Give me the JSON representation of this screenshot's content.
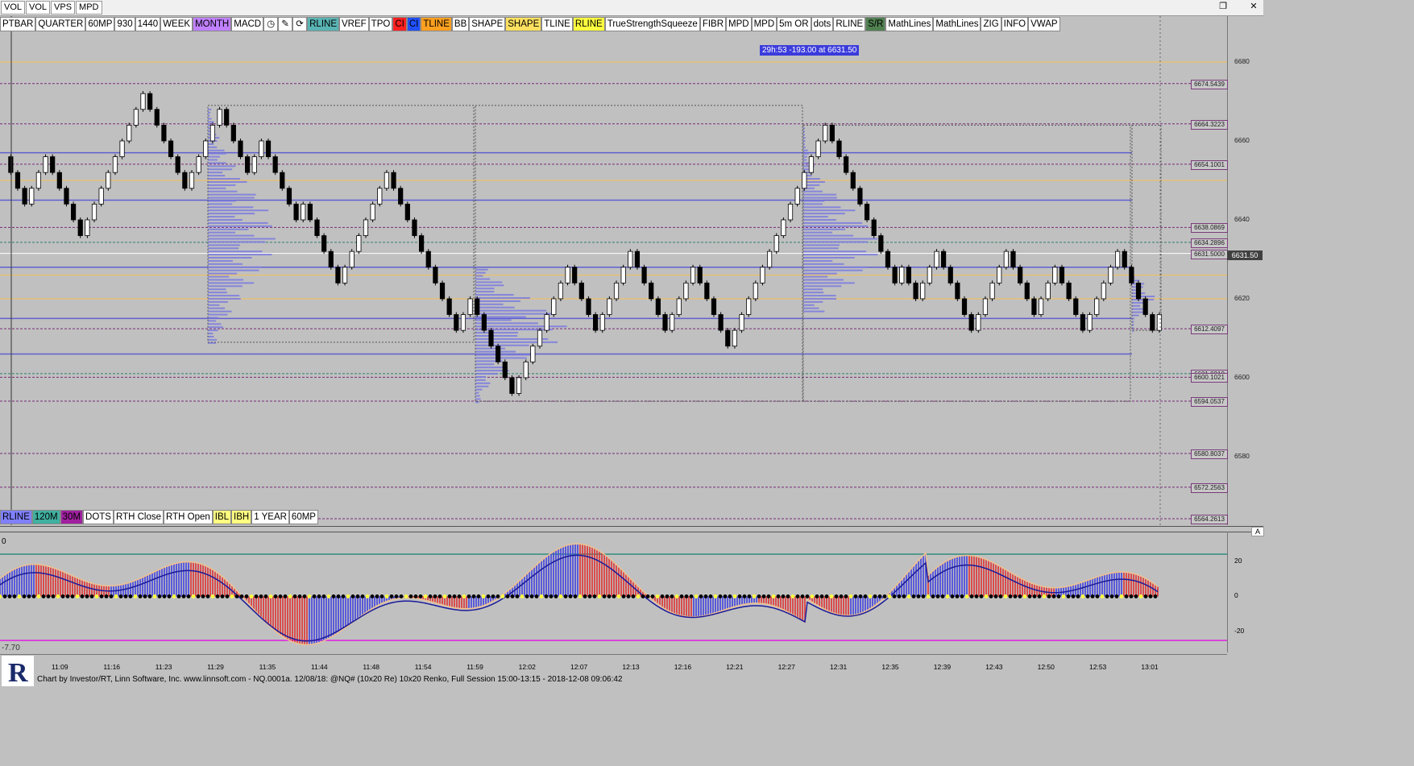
{
  "topbar": {
    "tabs": [
      "VOL",
      "VOL",
      "VPS",
      "MPD"
    ]
  },
  "toolbar": [
    {
      "label": "PTBAR",
      "bg": "#ffffff"
    },
    {
      "label": "QUARTER",
      "bg": "#ffffff"
    },
    {
      "label": "60MP",
      "bg": "#ffffff"
    },
    {
      "label": "930",
      "bg": "#ffffff"
    },
    {
      "label": "1440",
      "bg": "#ffffff"
    },
    {
      "label": "WEEK",
      "bg": "#ffffff"
    },
    {
      "label": "MONTH",
      "bg": "#c080ff"
    },
    {
      "label": "MACD",
      "bg": "#ffffff"
    },
    {
      "label": "",
      "bg": "#ffffff",
      "icon": "clock-icon",
      "glyph": "◷"
    },
    {
      "label": "",
      "bg": "#ffffff",
      "icon": "pencil-icon",
      "glyph": "✎"
    },
    {
      "label": "",
      "bg": "#ffffff",
      "icon": "refresh-icon",
      "glyph": "⟳"
    },
    {
      "label": "RLINE",
      "bg": "#5ab4b4"
    },
    {
      "label": "VREF",
      "bg": "#ffffff"
    },
    {
      "label": "TPO",
      "bg": "#ffffff"
    },
    {
      "label": "CI",
      "bg": "#ff2020"
    },
    {
      "label": "CI",
      "bg": "#2050ff"
    },
    {
      "label": "TLINE",
      "bg": "#ffa020"
    },
    {
      "label": "BB",
      "bg": "#ffffff"
    },
    {
      "label": "SHAPE",
      "bg": "#ffffff"
    },
    {
      "label": "SHAPE",
      "bg": "#ffe060"
    },
    {
      "label": "TLINE",
      "bg": "#ffffff"
    },
    {
      "label": "RLINE",
      "bg": "#ffff40"
    },
    {
      "label": "TrueStrengthSqueeze",
      "bg": "#ffffff"
    },
    {
      "label": "FIBR",
      "bg": "#ffffff"
    },
    {
      "label": "MPD",
      "bg": "#ffffff"
    },
    {
      "label": "MPD",
      "bg": "#ffffff"
    },
    {
      "label": "5m OR",
      "bg": "#ffffff"
    },
    {
      "label": "dots",
      "bg": "#ffffff"
    },
    {
      "label": "RLINE",
      "bg": "#ffffff"
    },
    {
      "label": "S/R",
      "bg": "#508050"
    },
    {
      "label": "MathLines",
      "bg": "#ffffff"
    },
    {
      "label": "MathLines",
      "bg": "#ffffff"
    },
    {
      "label": "ZIG",
      "bg": "#ffffff"
    },
    {
      "label": "INFO",
      "bg": "#ffffff"
    },
    {
      "label": "VWAP",
      "bg": "#ffffff"
    }
  ],
  "toolbar2": [
    {
      "label": "RLINE",
      "bg": "#8080ff"
    },
    {
      "label": "120M",
      "bg": "#40b0a0"
    },
    {
      "label": "30M",
      "bg": "#a020a0"
    },
    {
      "label": "DOTS",
      "bg": "#ffffff"
    },
    {
      "label": "RTH Close",
      "bg": "#ffffff"
    },
    {
      "label": "RTH Open",
      "bg": "#ffffff"
    },
    {
      "label": "IBL",
      "bg": "#ffff80"
    },
    {
      "label": "IBH",
      "bg": "#ffff80"
    },
    {
      "label": "1 YEAR",
      "bg": "#ffffff"
    },
    {
      "label": "60MP",
      "bg": "#ffffff"
    }
  ],
  "timer_text": "29h:53  -193.00 at 6631.50",
  "price_axis": {
    "min": 6564.2613,
    "max": 6690,
    "ticks": [
      "6680",
      "6660",
      "6640",
      "6620",
      "6600",
      "6580"
    ],
    "tick_values": [
      6680,
      6660,
      6640,
      6620,
      6600,
      6580
    ]
  },
  "levels": [
    {
      "label": "6674.5439",
      "value": 6674.5439,
      "color": "#7a2b7a",
      "style": "dash"
    },
    {
      "label": "6664.3223",
      "value": 6664.3223,
      "color": "#7a2b7a",
      "style": "dash"
    },
    {
      "label": "6654.1001",
      "value": 6654.1001,
      "color": "#7a2b7a",
      "style": "dash"
    },
    {
      "label": "6638.0869",
      "value": 6638.0869,
      "color": "#7a2b7a",
      "style": "dash"
    },
    {
      "label": "6634.2896",
      "value": 6634.2896,
      "color": "#2e7d6e",
      "style": "dash"
    },
    {
      "label": "6631.5000",
      "value": 6631.5,
      "color": "#ffffff",
      "style": "solid"
    },
    {
      "label": "6612.4097",
      "value": 6612.4097,
      "color": "#7a2b7a",
      "style": "dash"
    },
    {
      "label": "6601.0210",
      "value": 6601.021,
      "color": "#2e7d6e",
      "style": "dash"
    },
    {
      "label": "6600.1021",
      "value": 6600.1021,
      "color": "#7a2b7a",
      "style": "dash"
    },
    {
      "label": "6594.0537",
      "value": 6594.0537,
      "color": "#7a2b7a",
      "style": "dash"
    },
    {
      "label": "6580.8037",
      "value": 6580.8037,
      "color": "#7a2b7a",
      "style": "dash"
    },
    {
      "label": "6572.2563",
      "value": 6572.2563,
      "color": "#7a2b7a",
      "style": "dash"
    },
    {
      "label": "6564.2613",
      "value": 6564.2613,
      "color": "#7a2b7a",
      "style": "dash"
    }
  ],
  "current_price": "6631.50",
  "oscillator": {
    "ticks": [
      "20",
      "0",
      "-20"
    ],
    "tick_values": [
      20,
      0,
      -20
    ],
    "min": -30,
    "max": 35,
    "label_top": "0",
    "label_bottom": "-7.70"
  },
  "time_labels": [
    "11:09",
    "11:16",
    "11:23",
    "11:29",
    "11:35",
    "11:44",
    "11:48",
    "11:54",
    "11:59",
    "12:02",
    "12:07",
    "12:13",
    "12:16",
    "12:21",
    "12:27",
    "12:31",
    "12:35",
    "12:39",
    "12:43",
    "12:50",
    "12:53",
    "13:01"
  ],
  "renko_closes": [
    6656,
    6652,
    6648,
    6644,
    6648,
    6652,
    6656,
    6652,
    6648,
    6644,
    6640,
    6636,
    6640,
    6644,
    6648,
    6652,
    6656,
    6660,
    6664,
    6668,
    6672,
    6668,
    6664,
    6660,
    6656,
    6652,
    6648,
    6652,
    6656,
    6660,
    6664,
    6668,
    6664,
    6660,
    6656,
    6652,
    6656,
    6660,
    6656,
    6652,
    6648,
    6644,
    6640,
    6644,
    6640,
    6636,
    6632,
    6628,
    6624,
    6628,
    6632,
    6636,
    6640,
    6644,
    6648,
    6652,
    6648,
    6644,
    6640,
    6636,
    6632,
    6628,
    6624,
    6620,
    6616,
    6612,
    6616,
    6620,
    6616,
    6612,
    6608,
    6604,
    6600,
    6596,
    6600,
    6604,
    6608,
    6612,
    6616,
    6620,
    6624,
    6628,
    6624,
    6620,
    6616,
    6612,
    6616,
    6620,
    6624,
    6628,
    6632,
    6628,
    6624,
    6620,
    6616,
    6612,
    6616,
    6620,
    6624,
    6628,
    6624,
    6620,
    6616,
    6612,
    6608,
    6612,
    6616,
    6620,
    6624,
    6628,
    6632,
    6636,
    6640,
    6644,
    6648,
    6652,
    6656,
    6660,
    6664,
    6660,
    6656,
    6652,
    6648,
    6644,
    6640,
    6636,
    6632,
    6628,
    6624,
    6628,
    6624,
    6620,
    6624,
    6628,
    6632,
    6628,
    6624,
    6620,
    6616,
    6612,
    6616,
    6620,
    6624,
    6628,
    6632,
    6628,
    6624,
    6620,
    6616,
    6620,
    6624,
    6628,
    6624,
    6620,
    6616,
    6612,
    6616,
    6620,
    6624,
    6628,
    6632,
    6628,
    6624,
    6620,
    6616,
    6612,
    6616,
    6620,
    6624,
    6628,
    6632
  ],
  "footer": "Chart by Investor/RT, Linn Software, Inc. www.linnsoft.com - NQ.0001a.  12/08/18: @NQ# (10x20 Re) 10x20 Renko, Full Session 15:00-13:15 - 2018-12-08 09:06:42",
  "colors": {
    "bg": "#c0c0c0",
    "up": "#ffffff",
    "down": "#000000",
    "profile": "#7070e0",
    "osc_up": "#4040e0",
    "osc_down": "#e03030"
  }
}
